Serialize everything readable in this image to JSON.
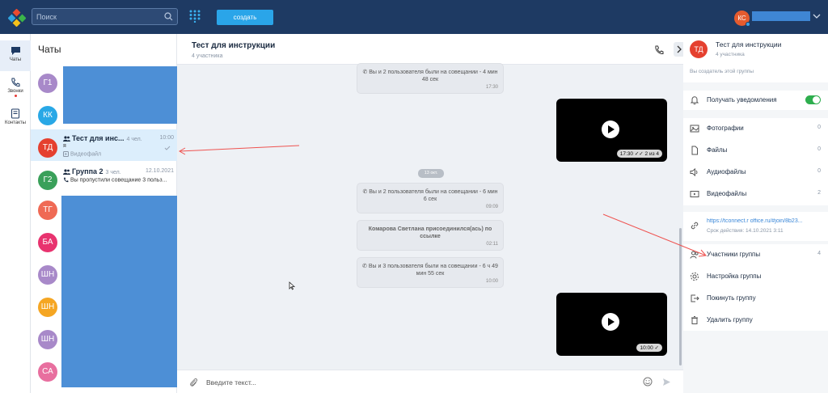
{
  "topbar": {
    "search_placeholder": "Поиск",
    "create_label": "создать",
    "user_initials": "КС"
  },
  "rail": [
    {
      "label": "Чаты",
      "icon": "chat-bubble-icon"
    },
    {
      "label": "Звонки",
      "icon": "phone-icon"
    },
    {
      "label": "Контакты",
      "icon": "contacts-book-icon"
    }
  ],
  "chatlist": {
    "title": "Чаты",
    "avatars": [
      {
        "initials": "Г1",
        "color": "#a889c9"
      },
      {
        "initials": "КК",
        "color": "#29a8e6"
      },
      {
        "initials": "ТД",
        "color": "#e5402f"
      },
      {
        "initials": "Г2",
        "color": "#3aa05a"
      },
      {
        "initials": "ТГ",
        "color": "#ef6a55"
      },
      {
        "initials": "БА",
        "color": "#e8336f"
      },
      {
        "initials": "ШН",
        "color": "#a889c9"
      },
      {
        "initials": "ШН",
        "color": "#f5a623"
      },
      {
        "initials": "ШН",
        "color": "#a889c9"
      },
      {
        "initials": "СА",
        "color": "#e86f9f"
      }
    ],
    "items": [
      {
        "title": "Тест для инс...",
        "meta": "4 чел.",
        "time": "10:00",
        "line1": "я",
        "line2": "Видеофайл"
      },
      {
        "title": "Группа 2",
        "meta": "3 чел.",
        "time": "12.10.2021",
        "line1": "Вы пропустили совещание 3 польз..."
      }
    ]
  },
  "conversation": {
    "title": "Тест для инструкции",
    "subtitle": "4 участника",
    "date_separator": "13 окт.",
    "messages": [
      {
        "text": "Вы и 2 пользователя были на совещании - 4 мин 48 сек",
        "time": "17:30"
      },
      {
        "text": "Вы и 2 пользователя были на совещании - 6 мин 6 сек",
        "time": "09:09"
      },
      {
        "text": "Комарова Светлана присоединился(ась) по ссылке",
        "time": "02:11"
      },
      {
        "text": "Вы и 3 пользователя были на совещании - 6 ч 49 мин 55 сек",
        "time": "10:00"
      }
    ],
    "videos": [
      {
        "time_label": "17:30 ✓✓ 2 из 4"
      },
      {
        "time_label": "10:00 ✓"
      }
    ],
    "composer_placeholder": "Введите текст..."
  },
  "info": {
    "initials": "ТД",
    "title": "Тест для инструкции",
    "count": "4 участника",
    "note": "Вы создатель этой группы",
    "notifications_label": "Получать уведомления",
    "notifications_on": true,
    "media": [
      {
        "label": "Фотографии",
        "value": "0",
        "icon": "photos-icon"
      },
      {
        "label": "Файлы",
        "value": "0",
        "icon": "file-icon"
      },
      {
        "label": "Аудиофайлы",
        "value": "0",
        "icon": "speaker-icon"
      },
      {
        "label": "Видеофайлы",
        "value": "2",
        "icon": "video-icon"
      }
    ],
    "link": {
      "url": "https://tconnect.r office.ru/#join/8b23...",
      "expiry": "Срок действия: 14.10.2021 3:11"
    },
    "actions": [
      {
        "label": "Участники группы",
        "value": "4",
        "icon": "members-icon"
      },
      {
        "label": "Настройка группы",
        "value": "",
        "icon": "settings-gear-icon"
      },
      {
        "label": "Покинуть группу",
        "value": "",
        "icon": "exit-icon"
      },
      {
        "label": "Удалить группу",
        "value": "",
        "icon": "trash-icon"
      }
    ]
  },
  "colors": {
    "accent": "#2aa5e9",
    "header": "#1e3a63",
    "toggle": "#2eae4e",
    "redacted": "#4d8fd6"
  }
}
